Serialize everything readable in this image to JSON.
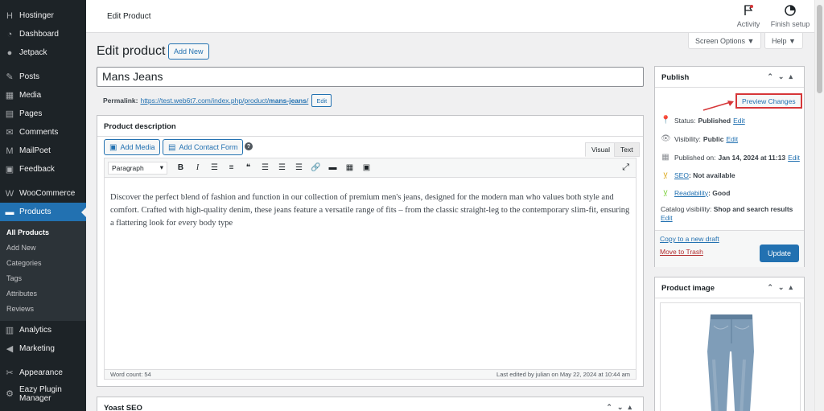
{
  "sidebar": {
    "items": [
      {
        "label": "Hostinger",
        "icon": "H"
      },
      {
        "label": "Dashboard",
        "icon": "◔"
      },
      {
        "label": "Jetpack",
        "icon": "●"
      },
      {
        "label": "Posts",
        "icon": "✎"
      },
      {
        "label": "Media",
        "icon": "▦"
      },
      {
        "label": "Pages",
        "icon": "▤"
      },
      {
        "label": "Comments",
        "icon": "✉"
      },
      {
        "label": "MailPoet",
        "icon": "M"
      },
      {
        "label": "Feedback",
        "icon": "▣"
      },
      {
        "label": "WooCommerce",
        "icon": "W"
      },
      {
        "label": "Products",
        "icon": "▬"
      }
    ],
    "submenu": [
      "All Products",
      "Add New",
      "Categories",
      "Tags",
      "Attributes",
      "Reviews"
    ],
    "items_bottom": [
      {
        "label": "Analytics",
        "icon": "▥"
      },
      {
        "label": "Marketing",
        "icon": "◀"
      },
      {
        "label": "Appearance",
        "icon": "✂"
      },
      {
        "label": "Eazy Plugin Manager",
        "icon": "⚙"
      }
    ]
  },
  "topbar": {
    "title": "Edit Product",
    "activity_label": "Activity",
    "finish_setup_label": "Finish setup",
    "screen_options_label": "Screen Options ▼",
    "help_label": "Help ▼"
  },
  "page": {
    "heading": "Edit product",
    "add_new_label": "Add New",
    "product_title": "Mans Jeans",
    "permalink_label": "Permalink:",
    "permalink_base": "https://test.web6t7.com/index.php/product/",
    "permalink_slug": "mans-jeans",
    "permalink_trail": "/",
    "permalink_edit": "Edit"
  },
  "description": {
    "header": "Product description",
    "add_media_label": "Add Media",
    "add_contact_form_label": "Add Contact Form",
    "tab_visual": "Visual",
    "tab_text": "Text",
    "format_select": "Paragraph",
    "content": "Discover the perfect blend of fashion and function in our collection of premium men's jeans, designed for the modern man who values both style and comfort. Crafted with high-quality denim, these jeans feature a versatile range of fits – from the classic straight-leg to the contemporary slim-fit, ensuring a flattering look for every body type",
    "word_count": "Word count: 54",
    "last_edited": "Last edited by julian on May 22, 2024 at 10:44 am"
  },
  "yoast": {
    "header": "Yoast SEO"
  },
  "publish": {
    "header": "Publish",
    "preview_changes_label": "Preview Changes",
    "status_label": "Status:",
    "status_value": "Published",
    "visibility_label": "Visibility:",
    "visibility_value": "Public",
    "published_on_label": "Published on:",
    "published_on_value": "Jan 14, 2024 at 11:13",
    "seo_link": "SEO",
    "seo_value": ": Not available",
    "readability_link": "Readability",
    "readability_value": ": Good",
    "catalog_label": "Catalog visibility:",
    "catalog_value": "Shop and search results",
    "edit": "Edit",
    "copy_to_draft": "Copy to a new draft",
    "move_to_trash": "Move to Trash",
    "update_label": "Update"
  },
  "product_image": {
    "header": "Product image"
  },
  "colors": {
    "accent": "#2271b1",
    "sidebar": "#1d2327",
    "highlight": "#d63638"
  }
}
